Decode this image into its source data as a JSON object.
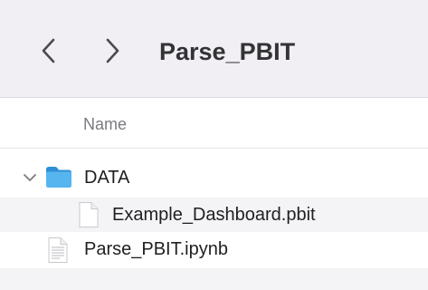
{
  "window": {
    "title": "Parse_PBIT"
  },
  "toolbar": {
    "back_icon": "chevron-left-icon",
    "forward_icon": "chevron-right-icon"
  },
  "list": {
    "columns": {
      "name": "Name"
    },
    "items": [
      {
        "name": "DATA",
        "kind": "folder",
        "expanded": true,
        "icon": "folder-icon",
        "depth": 0
      },
      {
        "name": "Example_Dashboard.pbit",
        "kind": "file",
        "icon": "document-icon",
        "depth": 1
      },
      {
        "name": "Parse_PBIT.ipynb",
        "kind": "file",
        "icon": "text-document-icon",
        "depth": 0
      }
    ]
  },
  "colors": {
    "toolbar_bg": "#f1eff3",
    "folder_blue": "#3fa6e6",
    "alt_row": "#f4f3f5",
    "header_text": "#7b7a80"
  }
}
